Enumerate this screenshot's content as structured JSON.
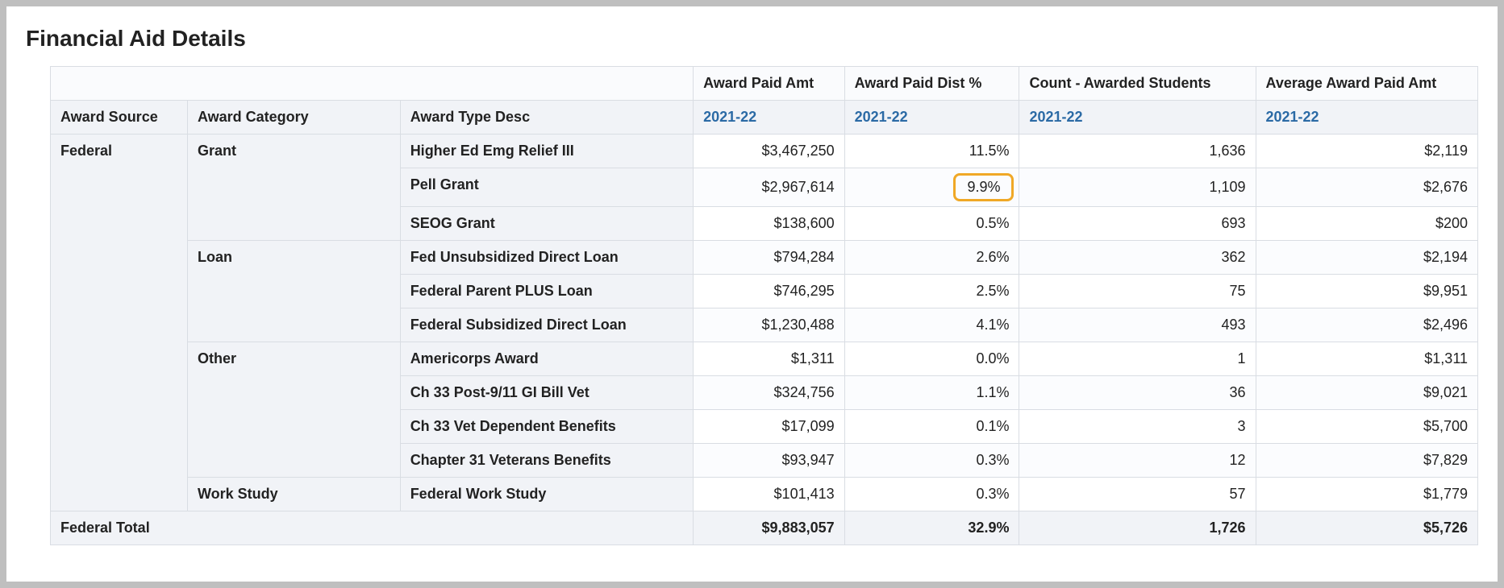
{
  "title": "Financial Aid Details",
  "headers": {
    "dim0": "Award Source",
    "dim1": "Award Category",
    "dim2": "Award Type Desc",
    "m0": "Award Paid Amt",
    "m1": "Award Paid Dist %",
    "m2": "Count - Awarded Students",
    "m3": "Average Award Paid Amt",
    "year": "2021-22"
  },
  "source": "Federal",
  "categories": [
    {
      "name": "Grant",
      "rows": [
        {
          "type": "Higher Ed Emg Relief III",
          "amt": "$3,467,250",
          "dist": "11.5%",
          "count": "1,636",
          "avg": "$2,119"
        },
        {
          "type": "Pell Grant",
          "amt": "$2,967,614",
          "dist": "9.9%",
          "count": "1,109",
          "avg": "$2,676",
          "highlight_dist": true
        },
        {
          "type": "SEOG Grant",
          "amt": "$138,600",
          "dist": "0.5%",
          "count": "693",
          "avg": "$200"
        }
      ]
    },
    {
      "name": "Loan",
      "rows": [
        {
          "type": "Fed Unsubsidized Direct Loan",
          "amt": "$794,284",
          "dist": "2.6%",
          "count": "362",
          "avg": "$2,194"
        },
        {
          "type": "Federal Parent PLUS Loan",
          "amt": "$746,295",
          "dist": "2.5%",
          "count": "75",
          "avg": "$9,951"
        },
        {
          "type": "Federal Subsidized Direct Loan",
          "amt": "$1,230,488",
          "dist": "4.1%",
          "count": "493",
          "avg": "$2,496"
        }
      ]
    },
    {
      "name": "Other",
      "rows": [
        {
          "type": "Americorps Award",
          "amt": "$1,311",
          "dist": "0.0%",
          "count": "1",
          "avg": "$1,311"
        },
        {
          "type": "Ch 33 Post-9/11 GI Bill Vet",
          "amt": "$324,756",
          "dist": "1.1%",
          "count": "36",
          "avg": "$9,021"
        },
        {
          "type": "Ch 33 Vet Dependent Benefits",
          "amt": "$17,099",
          "dist": "0.1%",
          "count": "3",
          "avg": "$5,700"
        },
        {
          "type": "Chapter 31 Veterans Benefits",
          "amt": "$93,947",
          "dist": "0.3%",
          "count": "12",
          "avg": "$7,829"
        }
      ]
    },
    {
      "name": "Work Study",
      "rows": [
        {
          "type": "Federal Work Study",
          "amt": "$101,413",
          "dist": "0.3%",
          "count": "57",
          "avg": "$1,779"
        }
      ]
    }
  ],
  "total": {
    "label": "Federal Total",
    "amt": "$9,883,057",
    "dist": "32.9%",
    "count": "1,726",
    "avg": "$5,726"
  }
}
